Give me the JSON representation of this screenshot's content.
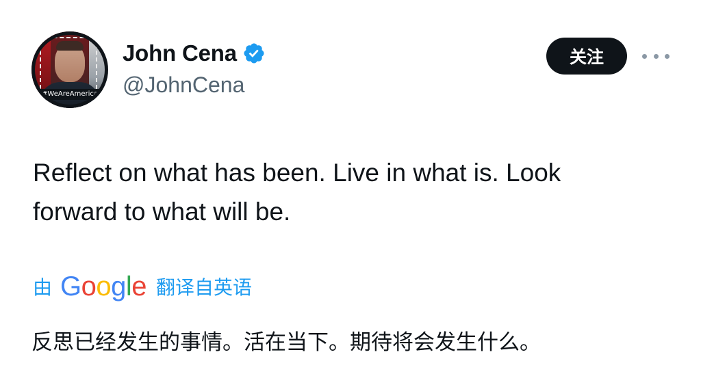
{
  "author": {
    "avatar_overlay_text": "#WeAreAmerica",
    "display_name": "John Cena",
    "verified": true,
    "handle": "@JohnCena"
  },
  "actions": {
    "follow_label": "关注",
    "more_icon": "more-horizontal-icon"
  },
  "tweet": {
    "text_line1": "Reflect on what has been. Live in what is. Look",
    "text_line2": "forward to what will be."
  },
  "translation": {
    "by_label": "由",
    "provider": "Google",
    "from_label": "翻译自英语",
    "text": "反思已经发生的事情。活在当下。期待将会发生什么。"
  },
  "colors": {
    "text_primary": "#0f1419",
    "text_secondary": "#536471",
    "accent_blue": "#1d9bf0",
    "verified_badge": "#1d9bf0",
    "follow_button_bg": "#0f1419",
    "google_blue": "#4285f4",
    "google_red": "#ea4335",
    "google_yellow": "#fbbc05",
    "google_green": "#34a853"
  }
}
